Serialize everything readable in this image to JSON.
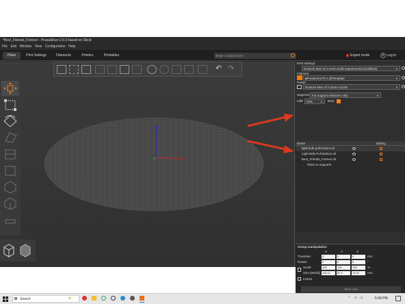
{
  "window": {
    "title": "*Best_Friends_Forever - PrusaSlicer-2.9.3 based on Slic3r"
  },
  "menu": [
    "File",
    "Edit",
    "Window",
    "View",
    "Configuration",
    "Help"
  ],
  "tabs": [
    {
      "label": "Plater",
      "active": true
    },
    {
      "label": "Print Settings",
      "active": false
    },
    {
      "label": "Filaments",
      "active": false
    },
    {
      "label": "Printers",
      "active": false
    },
    {
      "label": "Printables",
      "active": false
    }
  ],
  "search": {
    "placeholder": "Enter a search term"
  },
  "mode": {
    "label": "Expert mode",
    "color": "#e23c20"
  },
  "login": {
    "label": "Log in"
  },
  "sidebar": {
    "print_settings_label": "Print settings:",
    "print_settings_value": "Rostock Max V2 0.2mm Draft experimental (modified)",
    "filament_label": "Filament",
    "filament_value": "Prusament PLA @Template",
    "filament_color": "#f07c10",
    "printer_label": "Printer",
    "printer_value": "Rostock Max V2 0.5mm nozzle",
    "supports_label": "Supports:",
    "supports_value": "For support enforcers only",
    "infill_label": "Infill:",
    "infill_value": "20%",
    "brim_label": "Brim:",
    "objects_header_name": "Name",
    "objects_header_editing": "Editing",
    "objects": [
      "light-bulb-pull-bottom.stl",
      "Light Bulb Pull Bottom.stl",
      "Best_Friends_Forever.stl"
    ],
    "paint_on_supports": "Paint-on supports"
  },
  "group": {
    "title": "Group manipulation",
    "axes": [
      "X",
      "Y",
      "Z"
    ],
    "translate_label": "Translate:",
    "translate": [
      "0",
      "0",
      "0"
    ],
    "rotate_label": "Rotate:",
    "rotate": [
      "0",
      "0",
      "0"
    ],
    "scale_label": "Scale:",
    "scale": [
      "100",
      "100",
      "100"
    ],
    "size_label": "Size [World]:",
    "size": [
      "100.11",
      "87.4",
      "74.01"
    ],
    "unit_mm": "mm",
    "unit_deg": "°",
    "unit_pct": "%",
    "inches_label": "Inches",
    "slice_label": "Slice now"
  },
  "taskbar": {
    "search": "Search",
    "time": "5:46 PM"
  },
  "colors": {
    "accent": "#f08020",
    "annotation_arrow": "#d9391e"
  }
}
